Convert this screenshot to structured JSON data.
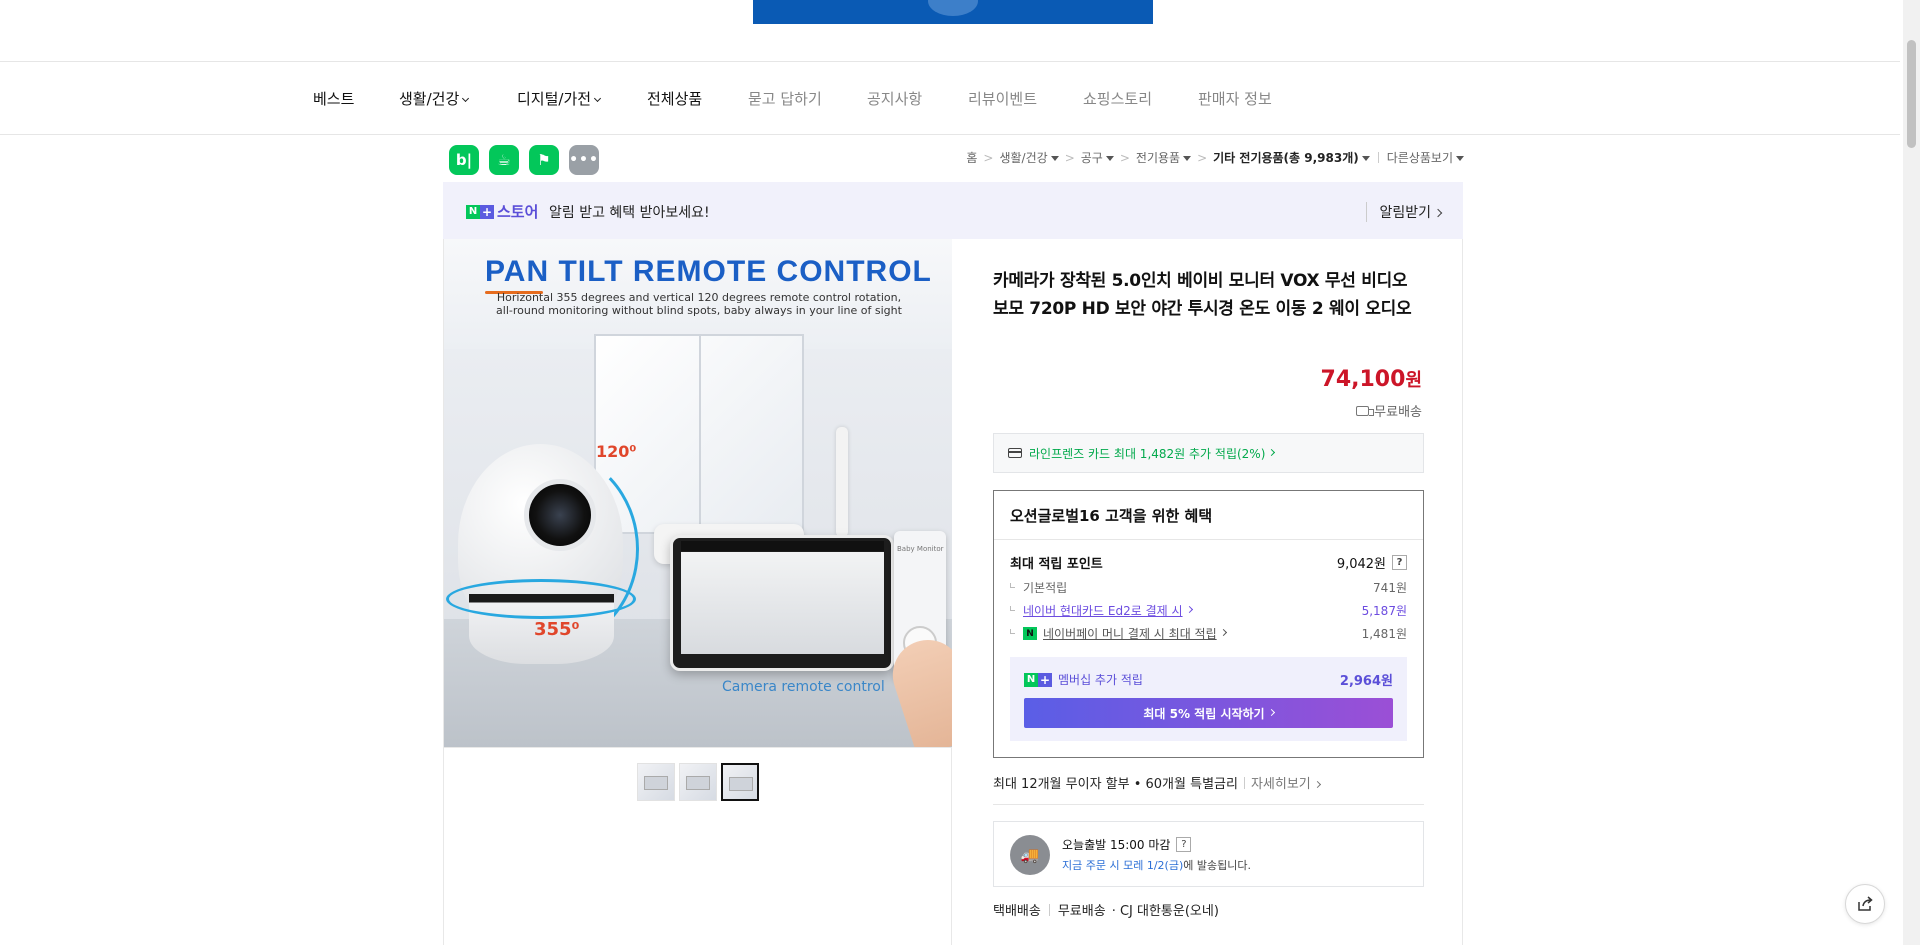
{
  "nav": {
    "items": [
      {
        "label": "베스트",
        "dropdown": false
      },
      {
        "label": "생활/건강",
        "dropdown": true
      },
      {
        "label": "디지털/가전",
        "dropdown": true
      },
      {
        "label": "전체상품",
        "dropdown": false
      },
      {
        "label": "묻고 답하기",
        "dropdown": false
      },
      {
        "label": "공지사항",
        "dropdown": false
      },
      {
        "label": "리뷰이벤트",
        "dropdown": false
      },
      {
        "label": "쇼핑스토리",
        "dropdown": false
      },
      {
        "label": "판매자 정보",
        "dropdown": false
      }
    ]
  },
  "toolbar": {
    "icons": [
      {
        "name": "blog-icon",
        "glyph": "b|",
        "color": "#03c75a"
      },
      {
        "name": "talktalk-icon",
        "glyph": "☕",
        "color": "#03c75a"
      },
      {
        "name": "bookmark-icon",
        "glyph": "⚑",
        "color": "#03c75a"
      },
      {
        "name": "more-icon",
        "glyph": "•••",
        "color": "#9aa0a6"
      }
    ]
  },
  "breadcrumb": {
    "home": "홈",
    "items": [
      "생활/건강",
      "공구",
      "전기용품"
    ],
    "current": "기타 전기용품(총 9,983개)",
    "other": "다른상품보기"
  },
  "store_bar": {
    "n_mark": "N",
    "plus_mark": "+",
    "store_word": "스토어",
    "message": "알림 받고 혜택 받아보세요!",
    "notify_label": "알림받기"
  },
  "image": {
    "promo_title": "PAN TILT REMOTE CONTROL",
    "promo_sub": "Horizontal 355 degrees and vertical 120 degrees remote control rotation, all-round monitoring without blind spots, baby always in your line of sight",
    "angle_v": "120⁰",
    "angle_h": "355⁰",
    "baby_monitor": "Baby Monitor",
    "caption": "Camera remote control",
    "thumbnails": 3,
    "active_thumbnail": 3
  },
  "product": {
    "title": "카메라가 장착된 5.0인치 베이비 모니터 VOX 무선 비디오 보모 720P HD 보안 야간 투시경 온도 이동 2 웨이 오디오",
    "price": "74,100",
    "currency": "원",
    "shipping": "무료배송",
    "card_benefit": "라인프렌즈 카드 최대 1,482원 추가 적립(2%)"
  },
  "benefit": {
    "title": "오션글로벌16 고객을 위한 혜택",
    "max_points_label": "최대 적립 포인트",
    "max_points_value": "9,042원",
    "help": "?",
    "rows": [
      {
        "label": "기본적립",
        "value": "741원"
      },
      {
        "label": "네이버 현대카드 Ed2로 결제 시",
        "value": "5,187원"
      },
      {
        "label": "네이버페이 머니 결제 시 최대 적립",
        "value": "1,481원",
        "badge": "N"
      }
    ],
    "membership_label": "멤버십 추가 적립",
    "membership_value": "2,964원",
    "membership_button": "최대 5% 적립 시작하기"
  },
  "installment": {
    "text": "최대 12개월 무이자 할부 • 60개월 특별금리",
    "detail": "자세히보기"
  },
  "delivery": {
    "headline": "오늘출발 15:00 마감",
    "help": "?",
    "highlight": "지금 주문 시 모레 1/2(금)",
    "suffix": "에 발송됩니다.",
    "method": "택배배송",
    "fee": "무료배송",
    "carrier": "· CJ 대한통운(오네)"
  },
  "colors": {
    "price": "#cc1528",
    "naver_green": "#03c75a",
    "membership_purple": "#6c4ce0",
    "banner_blue": "#0a5ab4"
  }
}
